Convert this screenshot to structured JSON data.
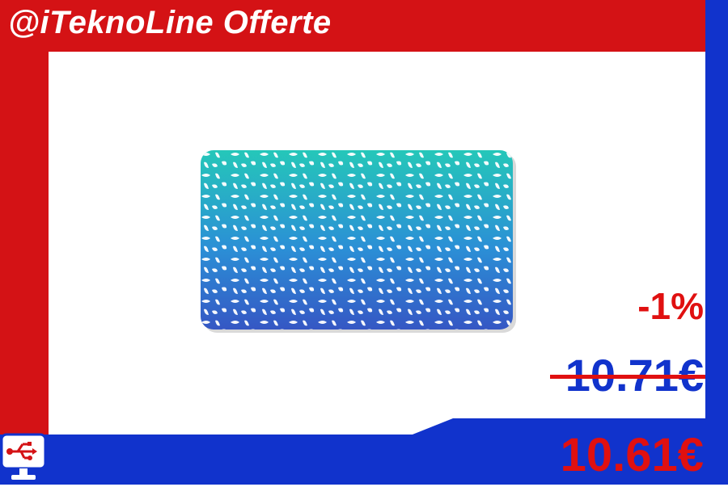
{
  "header": {
    "title": "@iTeknoLine Offerte"
  },
  "product": {
    "image": "mousepad-teal-blue-gradient-pattern"
  },
  "pricing": {
    "discount": "-1%",
    "old_price": "10.71€",
    "new_price": "10.61€"
  },
  "colors": {
    "brand_red": "#d41215",
    "brand_blue": "#1133cc",
    "price_red": "#e01010"
  },
  "logo": {
    "icon": "usb-monitor-icon"
  }
}
